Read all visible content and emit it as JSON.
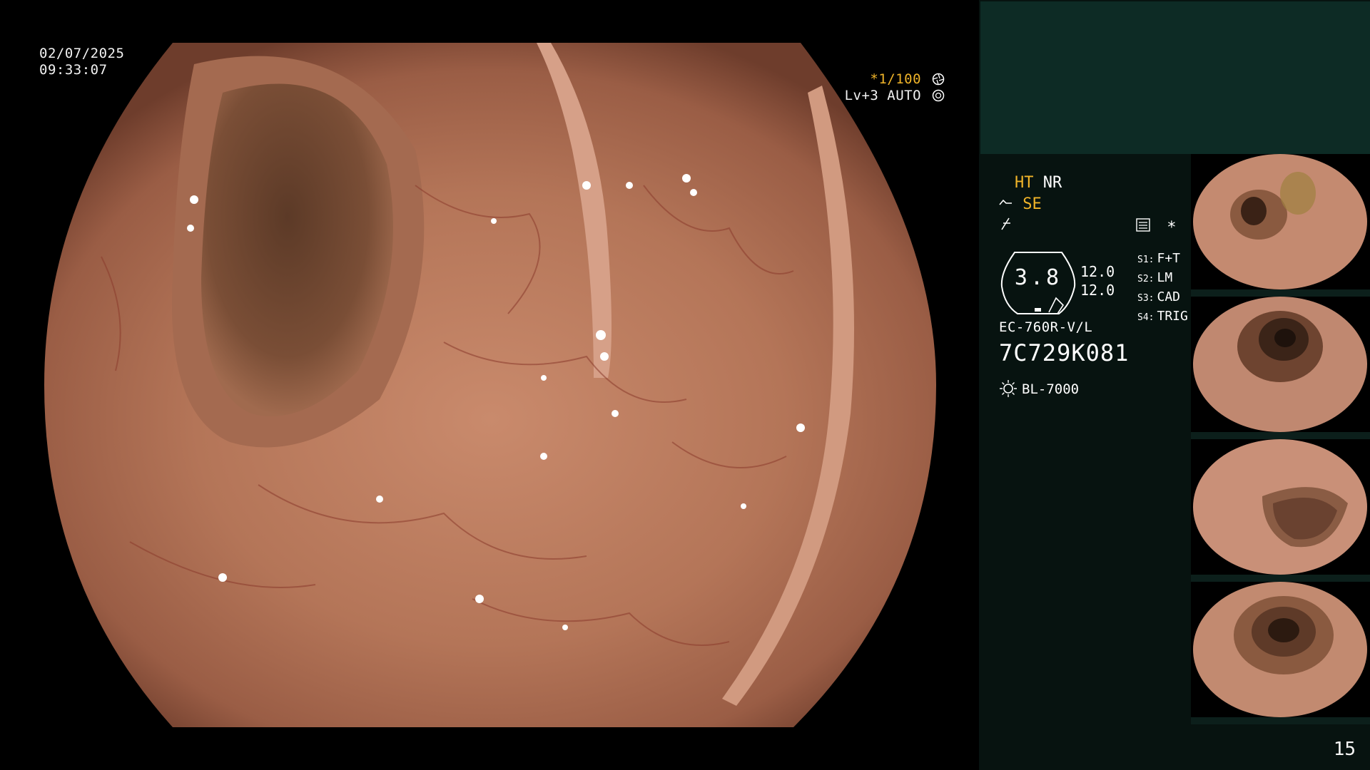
{
  "overlay": {
    "date": "02/07/2025",
    "time": "09:33:07",
    "shutter": "*1/100",
    "level": "Lv+3",
    "iris": "AUTO"
  },
  "panel": {
    "ht": "HT",
    "nr": "NR",
    "se": "SE",
    "star": "*",
    "zoom": "3.8",
    "enh_top": "12.0",
    "enh_bottom": "12.0",
    "switches": [
      {
        "key": "S1:",
        "value": "F+T"
      },
      {
        "key": "S2:",
        "value": "LM"
      },
      {
        "key": "S3:",
        "value": "CAD"
      },
      {
        "key": "S4:",
        "value": "TRIG"
      }
    ],
    "scope_model": "EC-760R-V/L",
    "scope_serial": "7C729K081",
    "light_source": "BL-7000",
    "page_number": "15"
  },
  "colors": {
    "accent_yellow": "#f0b429",
    "panel_bg": "#071310",
    "panel_top_bg": "#0d2b25",
    "mucosa": "#b97a60"
  },
  "icons": [
    "aperture-icon",
    "iris-icon",
    "scope-icon",
    "freeze-icon",
    "stack-icon",
    "light-source-icon"
  ]
}
